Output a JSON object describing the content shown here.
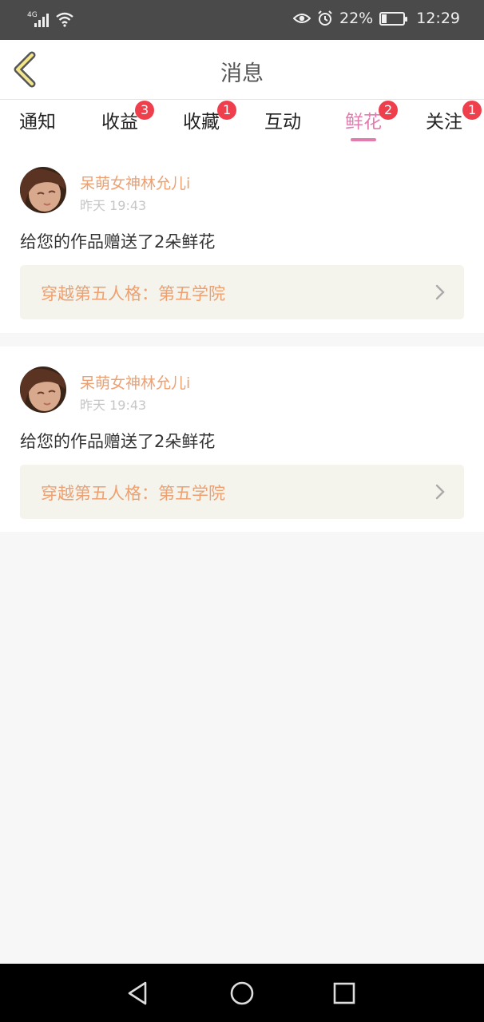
{
  "status_bar": {
    "network": "4G",
    "battery": "22%",
    "battery_fraction": 0.22,
    "time": "12:29",
    "icons": [
      "signal-icon",
      "wifi-icon",
      "eye-icon",
      "alarm-icon",
      "battery-icon"
    ]
  },
  "header": {
    "title": "消息",
    "back_icon": "chevron-left-icon"
  },
  "tabs": [
    {
      "label": "通知",
      "badge": ""
    },
    {
      "label": "收益",
      "badge": "3"
    },
    {
      "label": "收藏",
      "badge": "1"
    },
    {
      "label": "互动",
      "badge": ""
    },
    {
      "label": "鲜花",
      "badge": "2",
      "active": true
    },
    {
      "label": "关注",
      "badge": "1"
    }
  ],
  "messages": [
    {
      "user": "呆萌女神林允儿i",
      "time": "昨天 19:43",
      "text": "给您的作品赠送了2朵鲜花",
      "work_title": "穿越第五人格：第五学院"
    },
    {
      "user": "呆萌女神林允儿i",
      "time": "昨天 19:43",
      "text": "给您的作品赠送了2朵鲜花",
      "work_title": "穿越第五人格：第五学院"
    }
  ],
  "colors": {
    "accent_pink": "#e27cae",
    "name_orange": "#eea070",
    "badge_red": "#ef3f4d",
    "work_bg": "#f4f3ec"
  },
  "nav_bar": {
    "icons": [
      "back-triangle-icon",
      "home-circle-icon",
      "recents-square-icon"
    ]
  }
}
